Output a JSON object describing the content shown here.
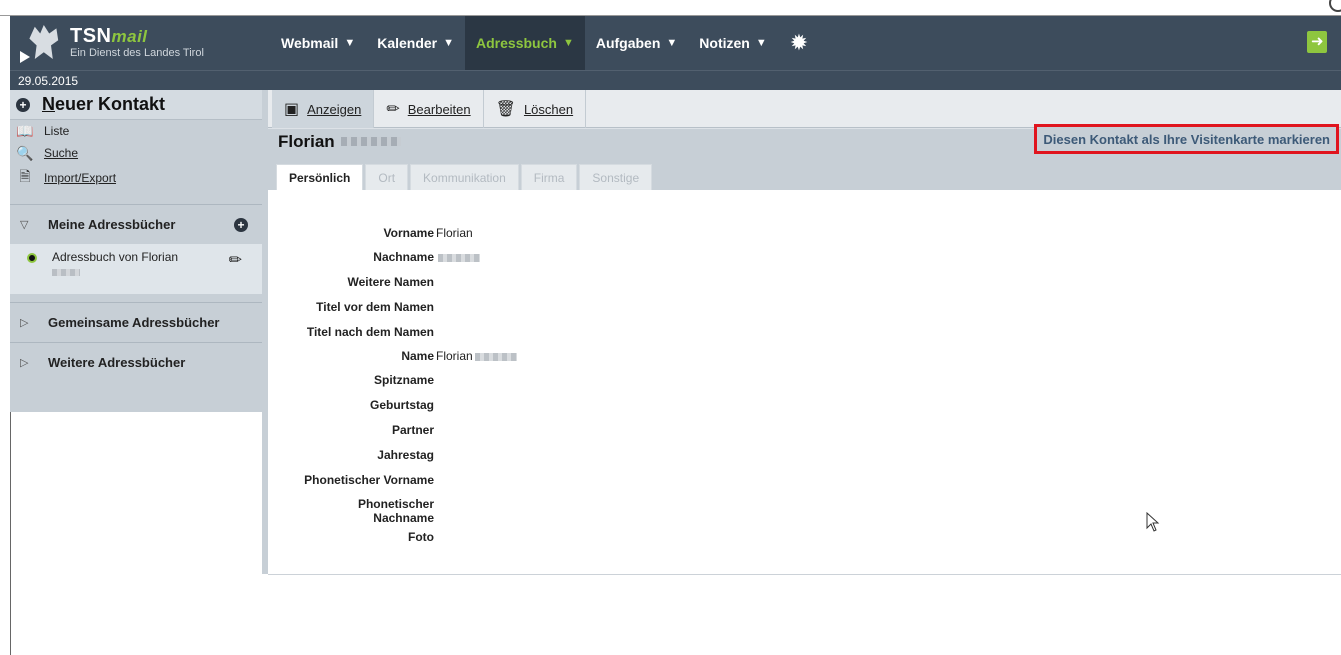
{
  "header": {
    "logo_title": "TSN",
    "logo_title_suffix": "mail",
    "logo_subtitle": "Ein Dienst des Landes Tirol",
    "nav": [
      {
        "label": "Webmail"
      },
      {
        "label": "Kalender"
      },
      {
        "label": "Adressbuch"
      },
      {
        "label": "Aufgaben"
      },
      {
        "label": "Notizen"
      }
    ],
    "date": "29.05.2015"
  },
  "sidebar": {
    "new_contact": "Neuer Kontakt",
    "new_contact_first": "N",
    "new_contact_rest": "euer Kontakt",
    "links": [
      {
        "label": "Liste",
        "icon": "book-icon"
      },
      {
        "label": "Suche",
        "icon": "search-icon"
      },
      {
        "label": "Import/Export",
        "icon": "import-export-icon"
      }
    ],
    "my_books": "Meine Adressbücher",
    "book_name": "Adressbuch von Florian",
    "shared_books": "Gemeinsame Adressbücher",
    "more_books": "Weitere Adressbücher"
  },
  "toolbar": {
    "show": "Anzeigen",
    "edit": "Bearbeiten",
    "delete": "Löschen"
  },
  "contact": {
    "first_name": "Florian",
    "vcard_link": "Diesen Kontakt als Ihre Visitenkarte markieren"
  },
  "tabs": [
    "Persönlich",
    "Ort",
    "Kommunikation",
    "Firma",
    "Sonstige"
  ],
  "fields": [
    {
      "label": "Vorname",
      "value": "Florian"
    },
    {
      "label": "Nachname",
      "value": ""
    },
    {
      "label": "Weitere Namen",
      "value": ""
    },
    {
      "label": "Titel vor dem Namen",
      "value": ""
    },
    {
      "label": "Titel nach dem Namen",
      "value": ""
    },
    {
      "label": "Name",
      "value": "Florian"
    },
    {
      "label": "Spitzname",
      "value": ""
    },
    {
      "label": "Geburtstag",
      "value": ""
    },
    {
      "label": "Partner",
      "value": ""
    },
    {
      "label": "Jahrestag",
      "value": ""
    },
    {
      "label": "Phonetischer Vorname",
      "value": ""
    },
    {
      "label": "Phonetischer Nachname",
      "value": ""
    },
    {
      "label": "Foto",
      "value": ""
    }
  ]
}
